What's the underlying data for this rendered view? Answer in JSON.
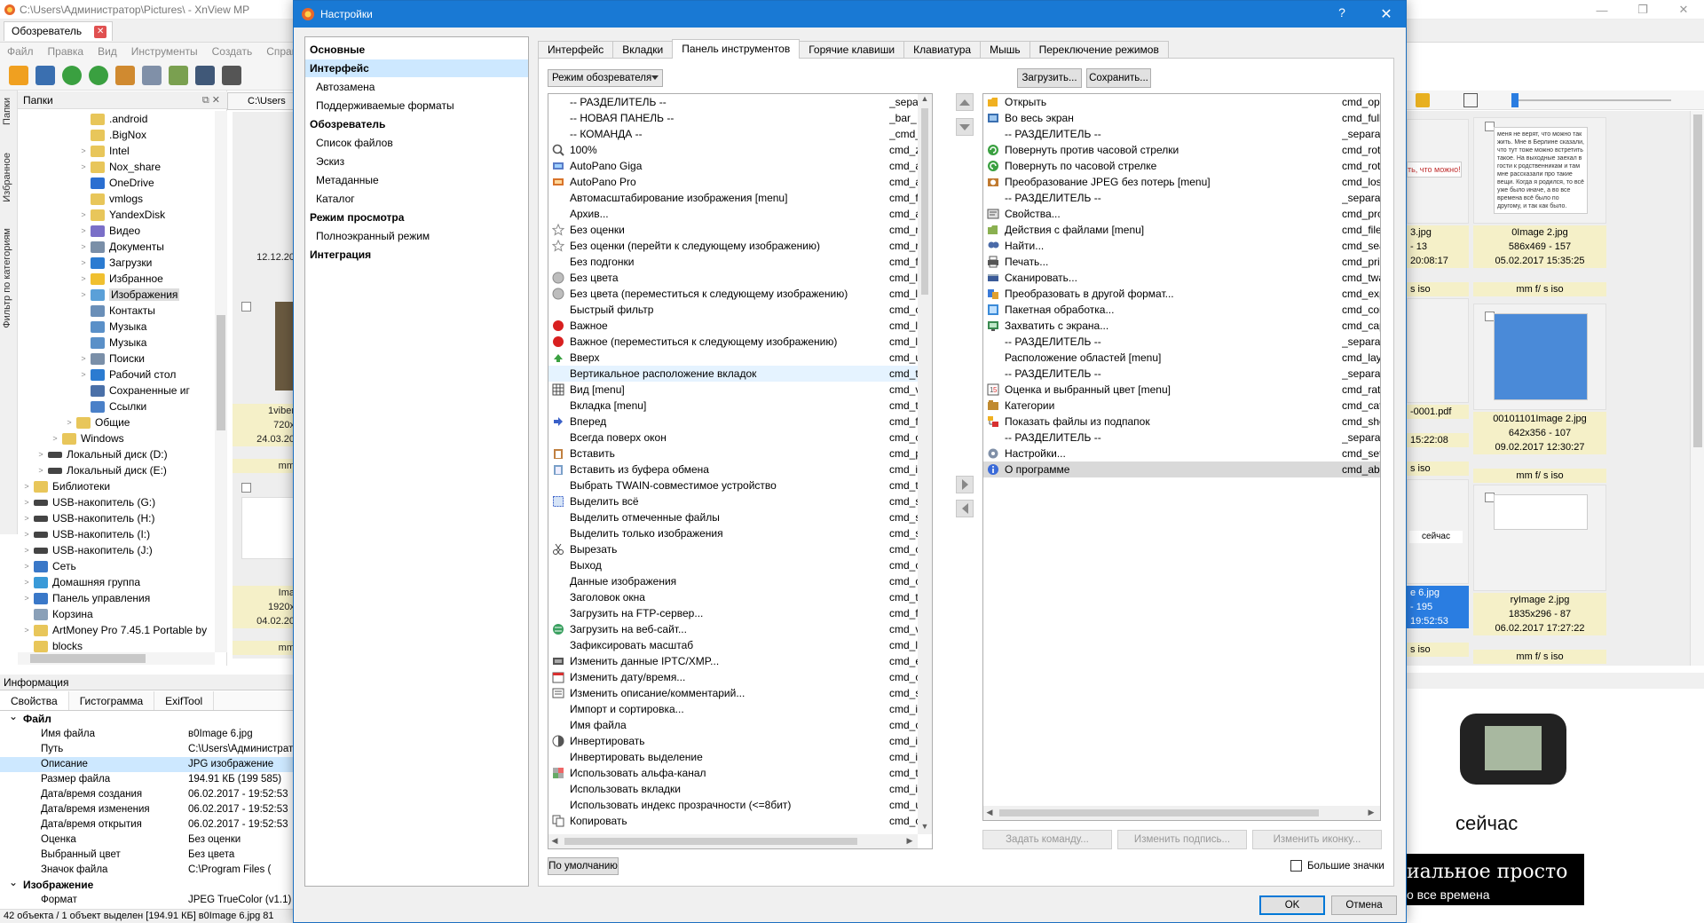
{
  "bg": {
    "title": "C:\\Users\\Администратор\\Pictures\\ - XnView MP",
    "tab": "Обозреватель",
    "menu": [
      "Файл",
      "Правка",
      "Вид",
      "Инструменты",
      "Создать",
      "Справ"
    ],
    "vtabs": [
      "Папки",
      "Избранное",
      "Фильтр по категориям"
    ],
    "folders_title": "Папки",
    "address": "C:\\Users",
    "left_thumb_date": "12.12.20",
    "left_thumb_meta": [
      {
        "lines": [
          "1viber",
          "720x",
          "24.03.20"
        ]
      },
      {
        "lines": [
          "mm"
        ]
      },
      {
        "lines": [
          "Ima",
          "1920x",
          "04.02.20"
        ]
      },
      {
        "lines": [
          "mm"
        ]
      }
    ],
    "tree": [
      {
        "label": ".android",
        "depth": 5,
        "exp": ""
      },
      {
        "label": ".BigNox",
        "depth": 5,
        "exp": ""
      },
      {
        "label": "Intel",
        "depth": 5,
        "exp": ">"
      },
      {
        "label": "Nox_share",
        "depth": 5,
        "exp": ">"
      },
      {
        "label": "OneDrive",
        "depth": 5,
        "exp": ""
      },
      {
        "label": "vmlogs",
        "depth": 5,
        "exp": ""
      },
      {
        "label": "YandexDisk",
        "depth": 5,
        "exp": ">"
      },
      {
        "label": "Видео",
        "depth": 5,
        "exp": ">"
      },
      {
        "label": "Документы",
        "depth": 5,
        "exp": ">"
      },
      {
        "label": "Загрузки",
        "depth": 5,
        "exp": ">"
      },
      {
        "label": "Избранное",
        "depth": 5,
        "exp": ">"
      },
      {
        "label": "Изображения",
        "depth": 5,
        "exp": ">",
        "sel": true
      },
      {
        "label": "Контакты",
        "depth": 5,
        "exp": ""
      },
      {
        "label": "Музыка",
        "depth": 5,
        "exp": ""
      },
      {
        "label": "Музыка",
        "depth": 5,
        "exp": ""
      },
      {
        "label": "Поиски",
        "depth": 5,
        "exp": ">"
      },
      {
        "label": "Рабочий стол",
        "depth": 5,
        "exp": ">"
      },
      {
        "label": "Сохраненные иг",
        "depth": 5,
        "exp": ""
      },
      {
        "label": "Ссылки",
        "depth": 5,
        "exp": ""
      },
      {
        "label": "Общие",
        "depth": 4,
        "exp": ">"
      },
      {
        "label": "Windows",
        "depth": 3,
        "exp": ">"
      },
      {
        "label": "Локальный диск (D:)",
        "depth": 2,
        "exp": ">"
      },
      {
        "label": "Локальный диск (E:)",
        "depth": 2,
        "exp": ">"
      },
      {
        "label": "Библиотеки",
        "depth": 1,
        "exp": ">"
      },
      {
        "label": "USB-накопитель (G:)",
        "depth": 1,
        "exp": ">"
      },
      {
        "label": "USB-накопитель (H:)",
        "depth": 1,
        "exp": ">"
      },
      {
        "label": "USB-накопитель (I:)",
        "depth": 1,
        "exp": ">"
      },
      {
        "label": "USB-накопитель (J:)",
        "depth": 1,
        "exp": ">"
      },
      {
        "label": "Сеть",
        "depth": 1,
        "exp": ">"
      },
      {
        "label": "Домашняя группа",
        "depth": 1,
        "exp": ">"
      },
      {
        "label": "Панель управления",
        "depth": 1,
        "exp": ">"
      },
      {
        "label": "Корзина",
        "depth": 1,
        "exp": ""
      },
      {
        "label": "ArtMoney Pro 7.45.1 Portable by",
        "depth": 1,
        "exp": ">"
      },
      {
        "label": "blocks",
        "depth": 1,
        "exp": ""
      }
    ],
    "info_title": "Информация",
    "info_tabs": [
      "Свойства",
      "Гистограмма",
      "ExifTool"
    ],
    "info_sections": [
      {
        "title": "Файл",
        "rows": [
          {
            "k": "Имя файла",
            "v": "в0Image 6.jpg"
          },
          {
            "k": "Путь",
            "v": "C:\\Users\\Администрат"
          },
          {
            "k": "Описание",
            "v": "JPG изображение",
            "hl": true
          },
          {
            "k": "Размер файла",
            "v": "194.91 КБ (199 585)"
          },
          {
            "k": "Дата/время создания",
            "v": "06.02.2017 - 19:52:53"
          },
          {
            "k": "Дата/время изменения",
            "v": "06.02.2017 - 19:52:53"
          },
          {
            "k": "Дата/время открытия",
            "v": "06.02.2017 - 19:52:53"
          },
          {
            "k": "Оценка",
            "v": "Без оценки"
          },
          {
            "k": "Выбранный цвет",
            "v": "Без цвета"
          },
          {
            "k": "Значок файла",
            "v": "C:\\Program Files ("
          }
        ]
      },
      {
        "title": "Изображение",
        "rows": [
          {
            "k": "Формат",
            "v": "JPEG TrueColor (v1.1)"
          }
        ]
      }
    ],
    "status": "42 объекта / 1 объект выделен [194.91 КБ]  в0Image 6.jpg  81",
    "right_thumbs": [
      {
        "name": "0Image 2.jpg",
        "l2": "586x469 - 157",
        "l3": "05.02.2017 15:35:25",
        "l4": "mm f/ s iso"
      },
      {
        "name": "00101101Image 2.jpg",
        "l2": "642x356 - 107",
        "l3": "09.02.2017 12:30:27",
        "l4": "mm f/ s iso"
      },
      {
        "name": "ryImage 2.jpg",
        "l2": "1835x296 - 87",
        "l3": "06.02.2017 17:27:22",
        "l4": "mm f/ s iso"
      }
    ],
    "right_partial": [
      {
        "l1": "3.jpg",
        "l2": "- 13",
        "l3": "20:08:17",
        "l4": "s iso"
      },
      {
        "l1": "-0001.pdf",
        "l2": "",
        "l3": "15:22:08",
        "l4": "s iso"
      },
      {
        "l1": "e 6.jpg",
        "l2": "- 195",
        "l3": "19:52:53",
        "l4": "s iso"
      }
    ],
    "partial_stamp": "ть, что можно!",
    "thumb_word": "сейчас",
    "preview_word": "сейчас",
    "preview_caption": "иальное просто",
    "preview_caption2": "о все времена",
    "note_text": "меня не верят, что можно так жить. Мне в Берлине сказали, что тут тоже можно встретить такое. На выходные заехал в гости к родственникам и там мне рассказали про такие вещи. Когда я родился, то всё уже было иначе, а во все времена всё было по другому, и так как было."
  },
  "dialog": {
    "title": "Настройки",
    "help": "?",
    "close": "✕",
    "nav": [
      {
        "label": "Основные",
        "type": "cat"
      },
      {
        "label": "Интерфейс",
        "type": "cat",
        "sel": true
      },
      {
        "label": "Автозамена",
        "type": "sub"
      },
      {
        "label": "Поддерживаемые форматы",
        "type": "sub"
      },
      {
        "label": "Обозреватель",
        "type": "cat"
      },
      {
        "label": "Список файлов",
        "type": "sub"
      },
      {
        "label": "Эскиз",
        "type": "sub"
      },
      {
        "label": "Метаданные",
        "type": "sub"
      },
      {
        "label": "Каталог",
        "type": "sub"
      },
      {
        "label": "Режим просмотра",
        "type": "cat"
      },
      {
        "label": "Полноэкранный режим",
        "type": "sub"
      },
      {
        "label": "Интеграция",
        "type": "cat"
      }
    ],
    "tabs": [
      {
        "label": "Интерфейс"
      },
      {
        "label": "Вкладки"
      },
      {
        "label": "Панель инструментов",
        "active": true
      },
      {
        "label": "Горячие клавиши"
      },
      {
        "label": "Клавиатура"
      },
      {
        "label": "Мышь"
      },
      {
        "label": "Переключение режимов"
      }
    ],
    "mode_select": "Режим обозревателя",
    "load_btn": "Загрузить...",
    "save_btn": "Сохранить...",
    "default_btn": "По умолчанию",
    "set_cmd_btn": "Задать команду...",
    "edit_label_btn": "Изменить подпись...",
    "edit_icon_btn": "Изменить иконку...",
    "big_icons": "Большие значки",
    "ok": "OK",
    "cancel": "Отмена",
    "left_list": [
      {
        "n": "-- РАЗДЕЛИТЕЛЬ --",
        "c": "_separ",
        "i": ""
      },
      {
        "n": "-- НОВАЯ ПАНЕЛЬ --",
        "c": "_bar_",
        "i": ""
      },
      {
        "n": "-- КОМАНДА --",
        "c": "_cmd_",
        "i": ""
      },
      {
        "n": "100%",
        "c": "cmd_z",
        "i": "zoom"
      },
      {
        "n": "AutoPano Giga",
        "c": "cmd_a",
        "i": "pano"
      },
      {
        "n": "AutoPano Pro",
        "c": "cmd_a",
        "i": "pano2"
      },
      {
        "n": "Автомасштабирование изображения [menu]",
        "c": "cmd_f",
        "i": ""
      },
      {
        "n": "Архив...",
        "c": "cmd_a",
        "i": ""
      },
      {
        "n": "Без оценки",
        "c": "cmd_r",
        "i": "star"
      },
      {
        "n": "Без оценки (перейти к следующему изображению)",
        "c": "cmd_r",
        "i": "star"
      },
      {
        "n": "Без подгонки",
        "c": "cmd_f",
        "i": ""
      },
      {
        "n": "Без цвета",
        "c": "cmd_l",
        "i": "grey"
      },
      {
        "n": "Без цвета (переместиться к следующему изображению)",
        "c": "cmd_l",
        "i": "grey"
      },
      {
        "n": "Быстрый фильтр",
        "c": "cmd_c",
        "i": ""
      },
      {
        "n": "Важное",
        "c": "cmd_l",
        "i": "red"
      },
      {
        "n": "Важное (переместиться к следующему изображению)",
        "c": "cmd_l",
        "i": "red"
      },
      {
        "n": "Вверх",
        "c": "cmd_u",
        "i": "up"
      },
      {
        "n": "Вертикальное расположение вкладок",
        "c": "cmd_t",
        "i": "",
        "hl": true
      },
      {
        "n": "Вид [menu]",
        "c": "cmd_v",
        "i": "grid"
      },
      {
        "n": "Вкладка [menu]",
        "c": "cmd_t",
        "i": ""
      },
      {
        "n": "Вперед",
        "c": "cmd_f",
        "i": "fwd"
      },
      {
        "n": "Всегда поверх окон",
        "c": "cmd_o",
        "i": ""
      },
      {
        "n": "Вставить",
        "c": "cmd_p",
        "i": "paste"
      },
      {
        "n": "Вставить из буфера обмена",
        "c": "cmd_i",
        "i": "clip"
      },
      {
        "n": "Выбрать TWAIN-совместимое устройство",
        "c": "cmd_t",
        "i": ""
      },
      {
        "n": "Выделить всё",
        "c": "cmd_s",
        "i": "selall"
      },
      {
        "n": "Выделить отмеченные файлы",
        "c": "cmd_s",
        "i": ""
      },
      {
        "n": "Выделить только изображения",
        "c": "cmd_s",
        "i": ""
      },
      {
        "n": "Вырезать",
        "c": "cmd_c",
        "i": "cut"
      },
      {
        "n": "Выход",
        "c": "cmd_c",
        "i": ""
      },
      {
        "n": "Данные изображения",
        "c": "cmd_c",
        "i": ""
      },
      {
        "n": "Заголовок окна",
        "c": "cmd_t",
        "i": ""
      },
      {
        "n": "Загрузить на FTP-сервер...",
        "c": "cmd_f",
        "i": ""
      },
      {
        "n": "Загрузить на веб-сайт...",
        "c": "cmd_v",
        "i": "web"
      },
      {
        "n": "Зафиксировать масштаб",
        "c": "cmd_l",
        "i": ""
      },
      {
        "n": "Изменить данные IPTC/XMP...",
        "c": "cmd_e",
        "i": "iptc"
      },
      {
        "n": "Изменить дату/время...",
        "c": "cmd_c",
        "i": "date"
      },
      {
        "n": "Изменить описание/комментарий...",
        "c": "cmd_s",
        "i": "desc"
      },
      {
        "n": "Импорт и сортировка...",
        "c": "cmd_i",
        "i": ""
      },
      {
        "n": "Имя файла",
        "c": "cmd_c",
        "i": ""
      },
      {
        "n": "Инвертировать",
        "c": "cmd_i",
        "i": "inv"
      },
      {
        "n": "Инвертировать выделение",
        "c": "cmd_i",
        "i": ""
      },
      {
        "n": "Использовать альфа-канал",
        "c": "cmd_t",
        "i": "alpha"
      },
      {
        "n": "Использовать вкладки",
        "c": "cmd_i",
        "i": ""
      },
      {
        "n": "Использовать индекс прозрачности (<=8бит)",
        "c": "cmd_u",
        "i": ""
      },
      {
        "n": "Копировать",
        "c": "cmd_c",
        "i": "copy"
      }
    ],
    "right_list": [
      {
        "n": "Открыть",
        "c": "cmd_ope",
        "i": "open"
      },
      {
        "n": "Во весь экран",
        "c": "cmd_fulls",
        "i": "full"
      },
      {
        "n": "-- РАЗДЕЛИТЕЛЬ --",
        "c": "_separato",
        "i": ""
      },
      {
        "n": "Повернуть против часовой стрелки",
        "c": "cmd_rota",
        "i": "rotl"
      },
      {
        "n": "Повернуть по часовой стрелке",
        "c": "cmd_rota",
        "i": "rotr"
      },
      {
        "n": "Преобразование JPEG без потерь [menu]",
        "c": "cmd_loss",
        "i": "jpeg"
      },
      {
        "n": "-- РАЗДЕЛИТЕЛЬ --",
        "c": "_separato",
        "i": ""
      },
      {
        "n": "Свойства...",
        "c": "cmd_prop",
        "i": "props"
      },
      {
        "n": "Действия с файлами [menu]",
        "c": "cmd_fileC",
        "i": "fileact"
      },
      {
        "n": "Найти...",
        "c": "cmd_sear",
        "i": "find"
      },
      {
        "n": "Печать...",
        "c": "cmd_prin",
        "i": "print"
      },
      {
        "n": "Сканировать...",
        "c": "cmd_twai",
        "i": "scan"
      },
      {
        "n": "Преобразовать в другой формат...",
        "c": "cmd_expo",
        "i": "conv"
      },
      {
        "n": "Пакетная обработка...",
        "c": "cmd_conv",
        "i": "batch"
      },
      {
        "n": "Захватить с экрана...",
        "c": "cmd_capt",
        "i": "capture"
      },
      {
        "n": "-- РАЗДЕЛИТЕЛЬ --",
        "c": "_separato",
        "i": ""
      },
      {
        "n": "Расположение областей [menu]",
        "c": "cmd_layo",
        "i": ""
      },
      {
        "n": "-- РАЗДЕЛИТЕЛЬ --",
        "c": "_separato",
        "i": ""
      },
      {
        "n": "Оценка и выбранный цвет [menu]",
        "c": "cmd_ratin",
        "i": "rate"
      },
      {
        "n": "Категории",
        "c": "cmd_cate",
        "i": "cat"
      },
      {
        "n": "Показать файлы из подпапок",
        "c": "cmd_show",
        "i": "sub"
      },
      {
        "n": "-- РАЗДЕЛИТЕЛЬ --",
        "c": "_separato",
        "i": ""
      },
      {
        "n": "Настройки...",
        "c": "cmd_setti",
        "i": "settings"
      },
      {
        "n": "О программе",
        "c": "cmd_abo",
        "i": "about",
        "sel": true
      }
    ]
  }
}
